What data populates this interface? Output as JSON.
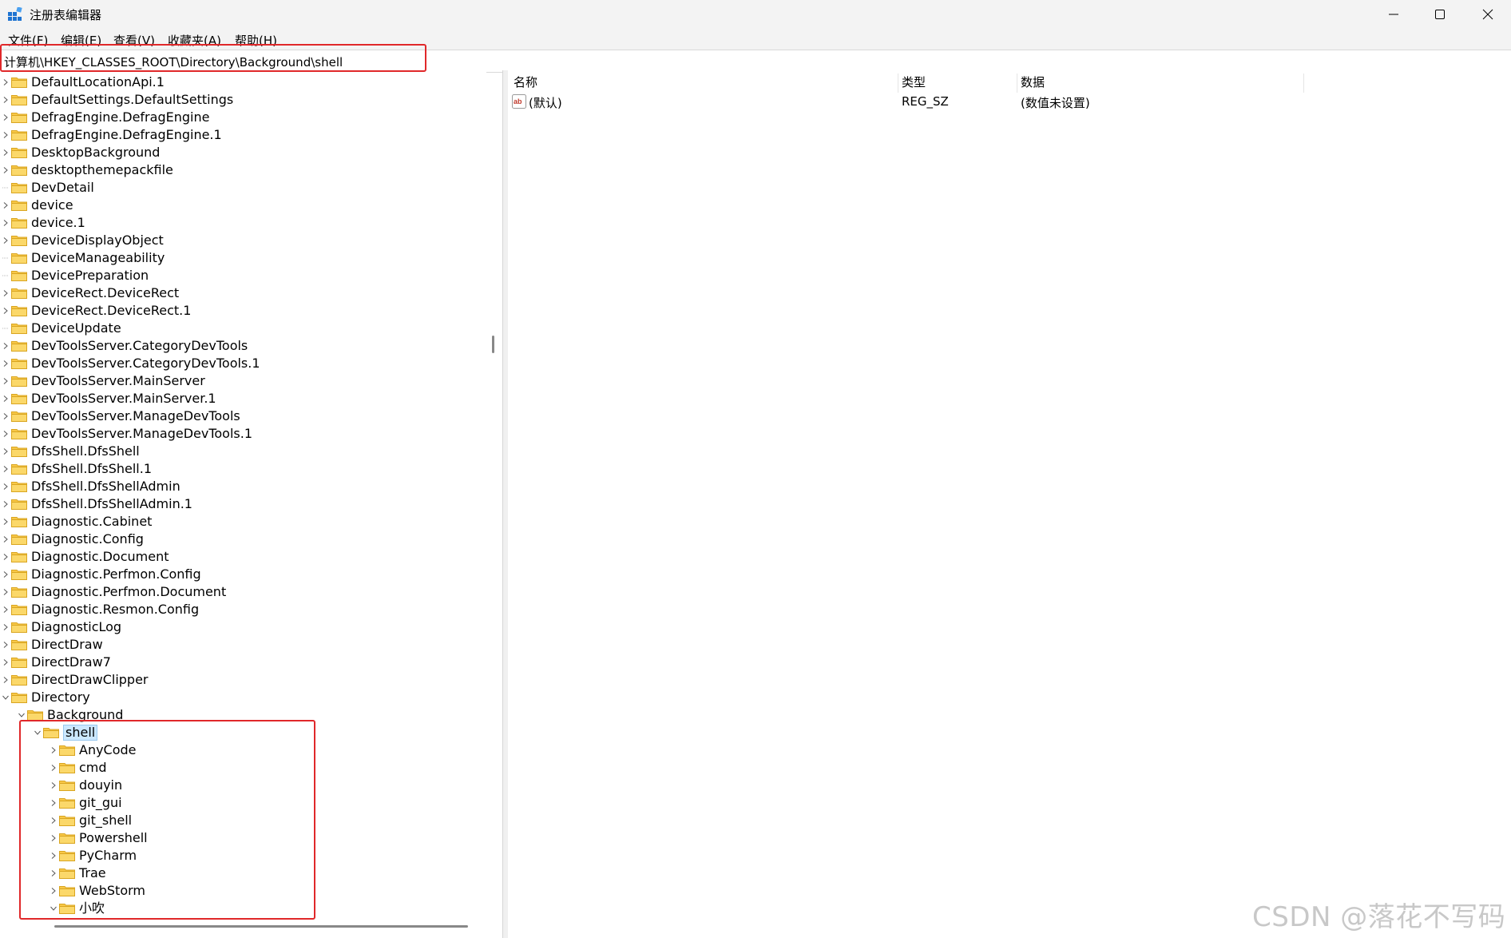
{
  "window": {
    "title": "注册表编辑器",
    "icon": "regedit-icon",
    "controls": [
      "minimize-icon",
      "maximize-icon",
      "close-icon"
    ]
  },
  "menu": [
    "文件(F)",
    "编辑(E)",
    "查看(V)",
    "收藏夹(A)",
    "帮助(H)"
  ],
  "address": "计算机\\HKEY_CLASSES_ROOT\\Directory\\Background\\shell",
  "tree": {
    "items": [
      {
        "label": "DefaultLocationApi.1",
        "level": 0,
        "expander": "collapsed"
      },
      {
        "label": "DefaultSettings.DefaultSettings",
        "level": 0,
        "expander": "collapsed"
      },
      {
        "label": "DefragEngine.DefragEngine",
        "level": 0,
        "expander": "collapsed"
      },
      {
        "label": "DefragEngine.DefragEngine.1",
        "level": 0,
        "expander": "collapsed"
      },
      {
        "label": "DesktopBackground",
        "level": 0,
        "expander": "collapsed"
      },
      {
        "label": "desktopthemepackfile",
        "level": 0,
        "expander": "collapsed"
      },
      {
        "label": "DevDetail",
        "level": 0,
        "expander": "none"
      },
      {
        "label": "device",
        "level": 0,
        "expander": "collapsed"
      },
      {
        "label": "device.1",
        "level": 0,
        "expander": "collapsed"
      },
      {
        "label": "DeviceDisplayObject",
        "level": 0,
        "expander": "collapsed"
      },
      {
        "label": "DeviceManageability",
        "level": 0,
        "expander": "none"
      },
      {
        "label": "DevicePreparation",
        "level": 0,
        "expander": "none"
      },
      {
        "label": "DeviceRect.DeviceRect",
        "level": 0,
        "expander": "collapsed"
      },
      {
        "label": "DeviceRect.DeviceRect.1",
        "level": 0,
        "expander": "collapsed"
      },
      {
        "label": "DeviceUpdate",
        "level": 0,
        "expander": "none"
      },
      {
        "label": "DevToolsServer.CategoryDevTools",
        "level": 0,
        "expander": "collapsed"
      },
      {
        "label": "DevToolsServer.CategoryDevTools.1",
        "level": 0,
        "expander": "collapsed"
      },
      {
        "label": "DevToolsServer.MainServer",
        "level": 0,
        "expander": "collapsed"
      },
      {
        "label": "DevToolsServer.MainServer.1",
        "level": 0,
        "expander": "collapsed"
      },
      {
        "label": "DevToolsServer.ManageDevTools",
        "level": 0,
        "expander": "collapsed"
      },
      {
        "label": "DevToolsServer.ManageDevTools.1",
        "level": 0,
        "expander": "collapsed"
      },
      {
        "label": "DfsShell.DfsShell",
        "level": 0,
        "expander": "collapsed"
      },
      {
        "label": "DfsShell.DfsShell.1",
        "level": 0,
        "expander": "collapsed"
      },
      {
        "label": "DfsShell.DfsShellAdmin",
        "level": 0,
        "expander": "collapsed"
      },
      {
        "label": "DfsShell.DfsShellAdmin.1",
        "level": 0,
        "expander": "collapsed"
      },
      {
        "label": "Diagnostic.Cabinet",
        "level": 0,
        "expander": "collapsed"
      },
      {
        "label": "Diagnostic.Config",
        "level": 0,
        "expander": "collapsed"
      },
      {
        "label": "Diagnostic.Document",
        "level": 0,
        "expander": "collapsed"
      },
      {
        "label": "Diagnostic.Perfmon.Config",
        "level": 0,
        "expander": "collapsed"
      },
      {
        "label": "Diagnostic.Perfmon.Document",
        "level": 0,
        "expander": "collapsed"
      },
      {
        "label": "Diagnostic.Resmon.Config",
        "level": 0,
        "expander": "collapsed"
      },
      {
        "label": "DiagnosticLog",
        "level": 0,
        "expander": "collapsed"
      },
      {
        "label": "DirectDraw",
        "level": 0,
        "expander": "collapsed"
      },
      {
        "label": "DirectDraw7",
        "level": 0,
        "expander": "collapsed"
      },
      {
        "label": "DirectDrawClipper",
        "level": 0,
        "expander": "collapsed"
      },
      {
        "label": "Directory",
        "level": 0,
        "expander": "expanded"
      },
      {
        "label": "Background",
        "level": 1,
        "expander": "expanded"
      },
      {
        "label": "shell",
        "level": 2,
        "expander": "expanded",
        "selected": true
      },
      {
        "label": "AnyCode",
        "level": 3,
        "expander": "collapsed"
      },
      {
        "label": "cmd",
        "level": 3,
        "expander": "collapsed"
      },
      {
        "label": "douyin",
        "level": 3,
        "expander": "collapsed"
      },
      {
        "label": "git_gui",
        "level": 3,
        "expander": "collapsed"
      },
      {
        "label": "git_shell",
        "level": 3,
        "expander": "collapsed"
      },
      {
        "label": "Powershell",
        "level": 3,
        "expander": "collapsed"
      },
      {
        "label": "PyCharm",
        "level": 3,
        "expander": "collapsed"
      },
      {
        "label": "Trae",
        "level": 3,
        "expander": "collapsed"
      },
      {
        "label": "WebStorm",
        "level": 3,
        "expander": "collapsed"
      },
      {
        "label": "小吹",
        "level": 3,
        "expander": "expanded"
      }
    ]
  },
  "values_pane": {
    "headers": {
      "name": "名称",
      "type": "类型",
      "data": "数据"
    },
    "rows": [
      {
        "icon": "string-value-icon",
        "name": "(默认)",
        "type": "REG_SZ",
        "data": "(数值未设置)"
      }
    ]
  },
  "watermark": "CSDN @落花不写码",
  "colors": {
    "folder": "#f8c848",
    "highlight_box": "#e0282a",
    "selection": "#cce8ff"
  }
}
